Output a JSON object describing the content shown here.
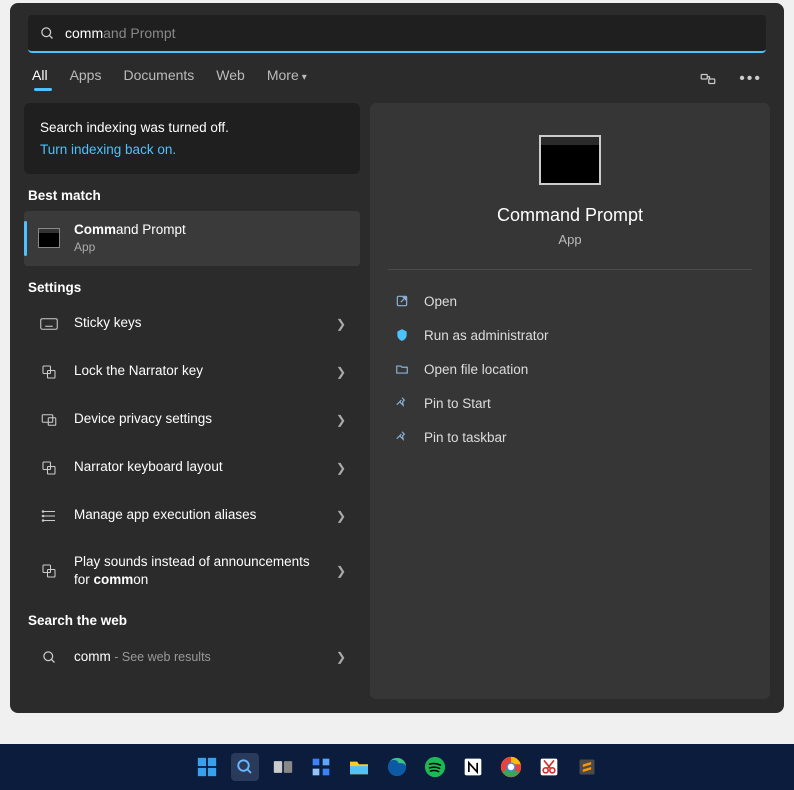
{
  "search": {
    "typed": "comm",
    "suggest": "and Prompt"
  },
  "tabs": {
    "all": "All",
    "apps": "Apps",
    "documents": "Documents",
    "web": "Web",
    "more": "More"
  },
  "indexing": {
    "msg": "Search indexing was turned off.",
    "link": "Turn indexing back on."
  },
  "sections": {
    "best_match": "Best match",
    "settings": "Settings",
    "search_web": "Search the web"
  },
  "best_match": {
    "title_bold": "Comm",
    "title_rest": "and Prompt",
    "sub": "App"
  },
  "settings_items": [
    {
      "label": "Sticky keys",
      "icon": "keyboard"
    },
    {
      "label": "Lock the Narrator key",
      "icon": "narrator"
    },
    {
      "label": "Device privacy settings",
      "icon": "privacy"
    },
    {
      "label": "Narrator keyboard layout",
      "icon": "narrator"
    },
    {
      "label": "Manage app execution aliases",
      "icon": "aliases"
    },
    {
      "label_pre": "Play sounds instead of announcements for ",
      "label_bold": "comm",
      "label_post": "on",
      "icon": "sound"
    }
  ],
  "web_item": {
    "query": "comm",
    "suffix": " - See web results"
  },
  "preview": {
    "title": "Command Prompt",
    "sub": "App",
    "actions": {
      "open": "Open",
      "run_admin": "Run as administrator",
      "open_loc": "Open file location",
      "pin_start": "Pin to Start",
      "pin_taskbar": "Pin to taskbar"
    }
  },
  "taskbar_icons": [
    "start",
    "search",
    "taskview",
    "widgets",
    "explorer",
    "edge",
    "spotify",
    "notion",
    "chrome",
    "snip",
    "sublime"
  ]
}
